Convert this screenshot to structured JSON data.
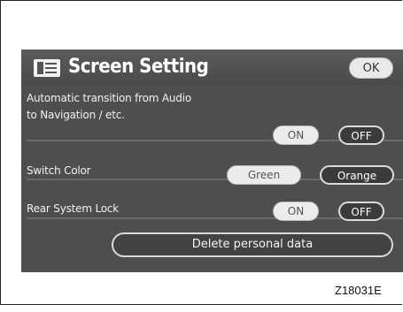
{
  "screen": {
    "title": "Screen Setting",
    "ok_label": "OK",
    "rows": [
      {
        "label_line1": "Automatic transition from Audio",
        "label_line2": "to Navigation / etc.",
        "options": [
          "ON",
          "OFF"
        ],
        "selected": "OFF"
      },
      {
        "label": "Switch Color",
        "options": [
          "Green",
          "Orange"
        ],
        "selected": "Orange"
      },
      {
        "label": "Rear System Lock",
        "options": [
          "ON",
          "OFF"
        ],
        "selected": "OFF"
      }
    ],
    "delete_label": "Delete personal data"
  },
  "caption": "Z18031E",
  "icons": {
    "title_icon": "menu-list-icon"
  }
}
